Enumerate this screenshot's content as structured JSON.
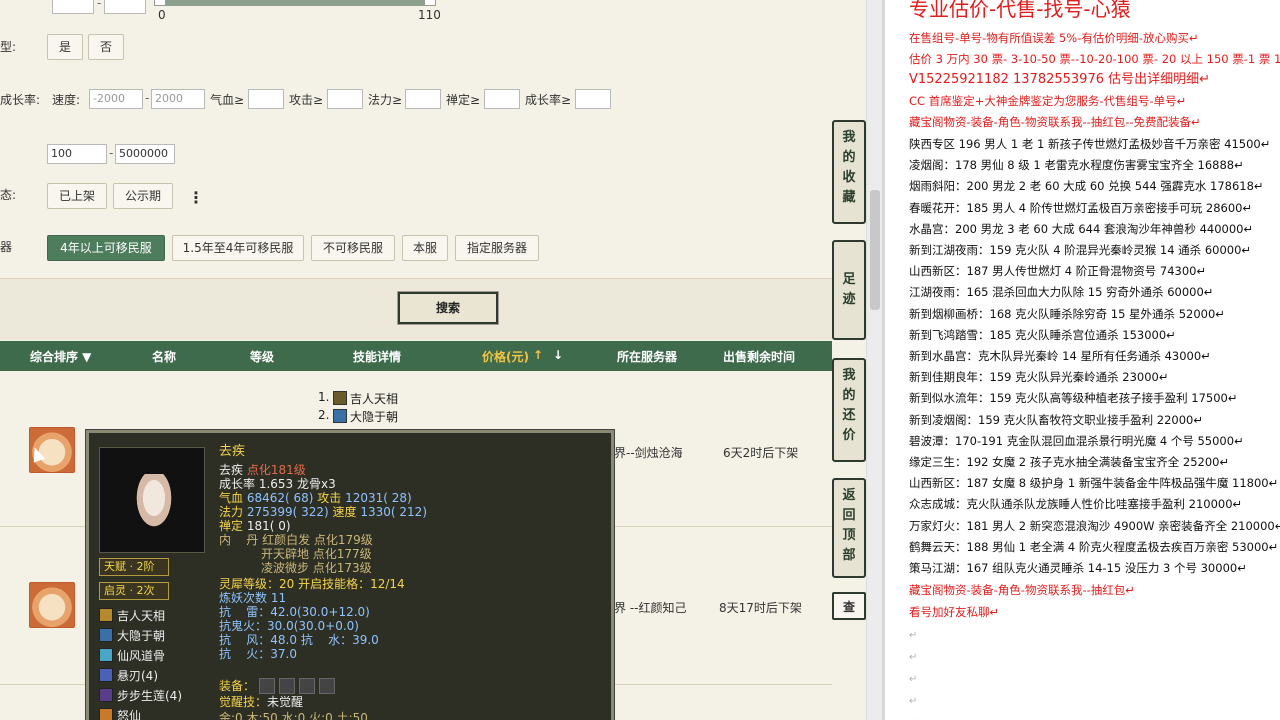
{
  "filters": {
    "slider": {
      "min": "0",
      "max": "110"
    },
    "type_row": {
      "label": "型:",
      "options": [
        "是",
        "否"
      ]
    },
    "growth_row": {
      "label": "成长率:",
      "speed_label": "速度:",
      "speed_min_ph": "-2000",
      "speed_max_ph": "2000",
      "hp_label": "气血≥",
      "atk_label": "攻击≥",
      "mp_label": "法力≥",
      "zen_label": "禅定≥",
      "growth_label": "成长率≥"
    },
    "price_row": {
      "min": "100",
      "max": "5000000"
    },
    "status_row": {
      "label": "态:",
      "options": [
        "已上架",
        "公示期"
      ],
      "more": "⋮"
    },
    "server_row": {
      "label": "器",
      "options": [
        "4年以上可移民服",
        "1.5年至4年可移民服",
        "不可移民服",
        "本服",
        "指定服务器"
      ]
    },
    "dash": "-",
    "search_label": "搜索"
  },
  "table": {
    "headers": [
      "综合排序 ▼",
      "名称",
      "等级",
      "技能详情",
      "价格(元)",
      "↑",
      "↓",
      "所在服务器",
      "出售剩余时间"
    ],
    "rows": [
      {
        "skills": [
          "1.",
          "吉人天相",
          "2.",
          "大隐于朝"
        ],
        "server": "界--剑烛沧海",
        "time": "6天2时后下架"
      },
      {
        "server": "界 --红颜知己",
        "time": "8天17时后下架",
        "view": "查"
      }
    ]
  },
  "side_buttons": [
    {
      "chars": [
        "我",
        "的",
        "收",
        "藏"
      ]
    },
    {
      "chars": [
        "足",
        "迹"
      ]
    },
    {
      "chars": [
        "我",
        "的",
        "还",
        "价"
      ]
    },
    {
      "chars": [
        "返",
        "回",
        "顶",
        "部"
      ]
    }
  ],
  "tooltip": {
    "name": "去疾",
    "lines": [
      {
        "a": "去疾 ",
        "b": "点化181级"
      },
      {
        "a": "成长率 1.653 龙骨x3"
      },
      {
        "a": "气血 ",
        "b": "68462( 68) ",
        "c": "攻击 ",
        "d": "12031( 28)"
      },
      {
        "a": "法力 ",
        "b": "275399( 322) ",
        "c": "速度 ",
        "d": "1330( 212)"
      },
      {
        "a": "禅定 ",
        "b": "181( 0)"
      },
      {
        "a": "内    丹 红颜白发 点化179级"
      },
      {
        "a": "           开天辟地 点化177级"
      },
      {
        "a": "           凌波微步 点化173级"
      },
      {
        "a": "灵犀等级：20 开启技能格：12/14"
      },
      {
        "a": "炼妖次数 11"
      },
      {
        "a": "抗    雷：",
        "b": "42.0(30.0+12.0)"
      },
      {
        "a": "抗鬼火：",
        "b": "30.0(30.0+0.0)"
      },
      {
        "a": "抗    风：",
        "b": "48.0 ",
        "c": "抗    水：",
        "d": "39.0"
      },
      {
        "a": "抗    火：",
        "b": "37.0"
      }
    ],
    "equip_label": "装备：",
    "awaken": {
      "label": "觉醒技：",
      "value": "未觉醒"
    },
    "elements": "金:0 木:50 水:0 火:0 土:50",
    "tags": [
      "天赋 · 2阶",
      "启灵 · 2次"
    ],
    "skills": [
      "吉人天相",
      "大隐于朝",
      "仙风道骨",
      "悬刃(4)",
      "步步生莲(4)",
      "怒仙"
    ]
  },
  "doc": {
    "title": "专业估价-代售-找号-心猿",
    "lines": [
      {
        "t": "在售组号-单号-物有所值误差 5%-有估价明细-放心购买↵",
        "c": "red"
      },
      {
        "t": "估价 3 万内 30 票- 3-10-50 票--10-20-100 票- 20 以上 150 票-1 票 1 元↵",
        "c": "red"
      },
      {
        "t": "V15225921182      13782553976    估号出详细明细↵",
        "c": "red",
        "big": true
      },
      {
        "t": "CC 首席鉴定+大神金牌鉴定为您服务-代售组号-单号↵",
        "c": "red"
      },
      {
        "t": "藏宝阁物资-装备-角色-物资联系我--抽红包--免费配装备↵",
        "c": "red"
      },
      {
        "t": "陕西专区 196 男人 1 老 1 新孩子传世燃灯孟极妙音千万亲密 41500↵",
        "c": "black"
      },
      {
        "t": "凌烟阁：178 男仙 8 级 1 老雷克水程度伤害雾宝宝齐全 16888↵",
        "c": "black"
      },
      {
        "t": "烟雨斜阳：200 男龙 2 老 60 大成 60 兑换 544 强霹克水 178618↵",
        "c": "black"
      },
      {
        "t": "春暖花开：185 男人 4 阶传世燃灯孟极百万亲密接手可玩 28600↵",
        "c": "black"
      },
      {
        "t": "水晶宫：200 男龙 3 老 60 大成 644 套浪淘沙年神兽秒 440000↵",
        "c": "black"
      },
      {
        "t": "新到江湖夜雨：159 克火队 4 阶混异光秦岭灵猴 14 通杀 60000↵",
        "c": "black"
      },
      {
        "t": "山西新区：187 男人传世燃灯 4 阶正骨混物资号 74300↵",
        "c": "black"
      },
      {
        "t": "江湖夜雨：165 混杀回血大力队除 15 穷奇外通杀 60000↵",
        "c": "black"
      },
      {
        "t": "新到烟柳画桥：168 克火队睡杀除穷奇 15 星外通杀 52000↵",
        "c": "black"
      },
      {
        "t": "新到飞鸿踏雪：185 克火队睡杀宫位通杀 153000↵",
        "c": "black"
      },
      {
        "t": "新到水晶宫：克木队异光秦岭 14 星所有任务通杀 43000↵",
        "c": "black"
      },
      {
        "t": "新到佳期良年：159 克火队异光秦岭通杀 23000↵",
        "c": "black"
      },
      {
        "t": "新到似水流年：159 克火队高等级种植老孩子接手盈利 17500↵",
        "c": "black"
      },
      {
        "t": "新到凌烟阁：159 克火队畜牧符文职业接手盈利 22000↵",
        "c": "black"
      },
      {
        "t": "碧波潭：170-191 克金队混回血混杀景行明光魔 4 个号 55000↵",
        "c": "black"
      },
      {
        "t": "缘定三生：192 女魔 2 孩子克水抽全满装备宝宝齐全 25200↵",
        "c": "black"
      },
      {
        "t": "山西新区：187 女魔 8 级护身 1 新强牛装备金牛阵极品强牛魔 11800↵",
        "c": "black"
      },
      {
        "t": "众志成城：克火队通杀队龙族睡人性价比哇塞接手盈利 210000↵",
        "c": "black"
      },
      {
        "t": "万家灯火：181 男人 2 新突恋混浪淘沙 4900W 亲密装备齐全 210000↵",
        "c": "black"
      },
      {
        "t": "鹤舞云天：188 男仙 1 老全满 4 阶克火程度孟极去疾百万亲密 53000↵",
        "c": "black"
      },
      {
        "t": "策马江湖：167 组队克火通灵睡杀 14-15 没压力 3 个号 30000↵",
        "c": "black"
      },
      {
        "t": "藏宝阁物资-装备-角色-物资联系我--抽红包↵",
        "c": "red"
      },
      {
        "t": "看号加好友私聊↵",
        "c": "red"
      }
    ],
    "tail_marks": [
      "↵",
      "↵",
      "↵",
      "↵",
      "↵"
    ]
  }
}
